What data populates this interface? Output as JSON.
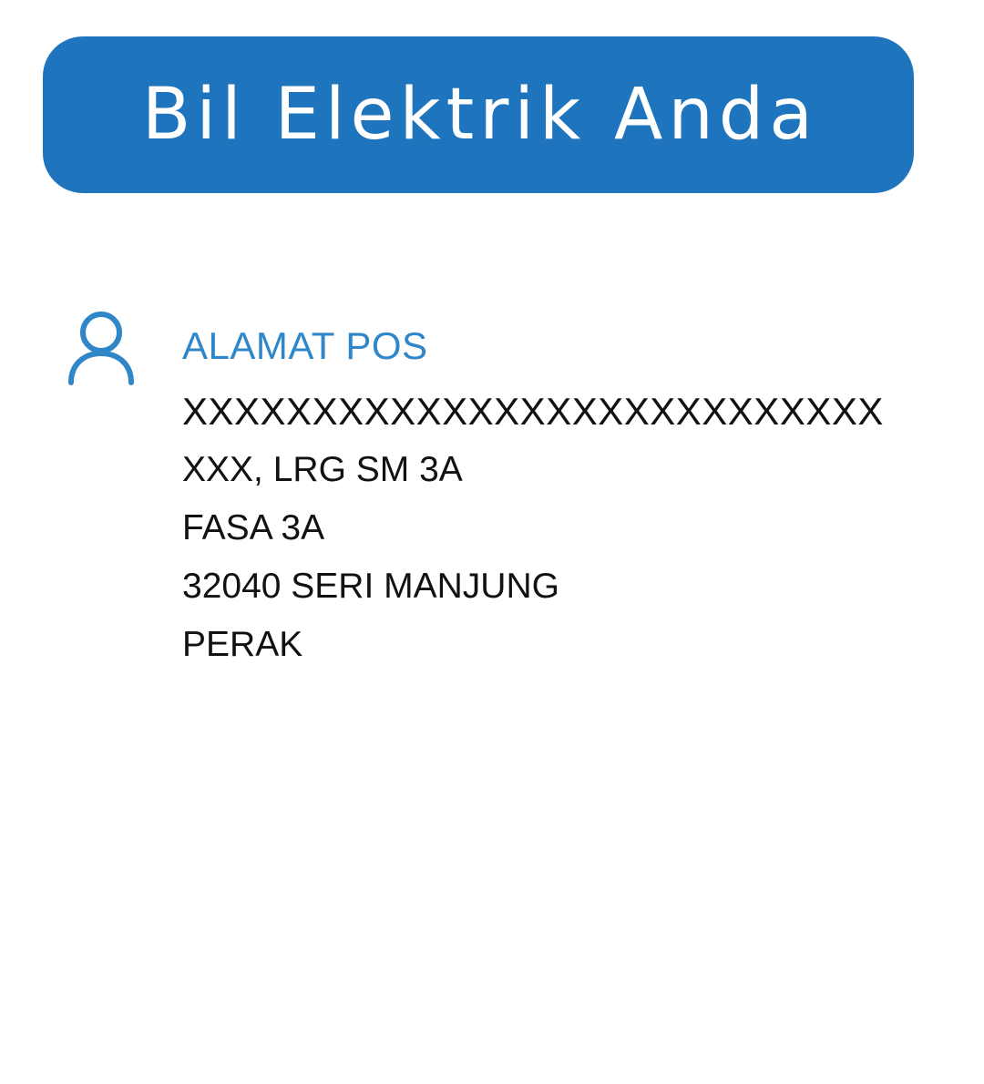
{
  "header": {
    "title": "Bil Elektrik Anda"
  },
  "address": {
    "icon": "person-icon",
    "label": "ALAMAT POS",
    "lines": [
      "XXXXXXXXXXXXXXXXXXXXXXXXXXX",
      "XXX, LRG SM 3A",
      "FASA 3A",
      "32040 SERI MANJUNG",
      "PERAK"
    ]
  },
  "colors": {
    "banner": "#1f74be",
    "accent": "#2f86c9",
    "text": "#111111",
    "background": "#ffffff"
  }
}
